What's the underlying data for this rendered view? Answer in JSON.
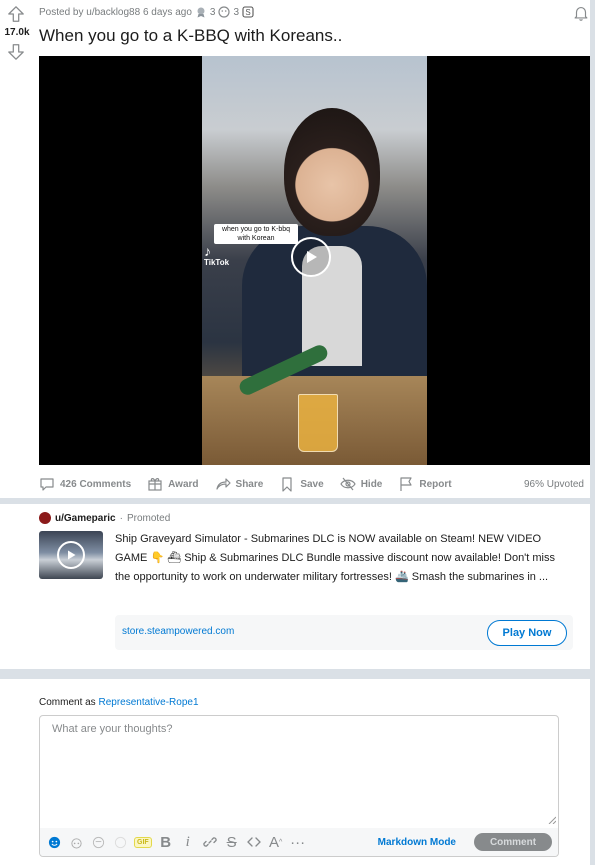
{
  "post": {
    "vote_count": "17.0k",
    "posted_by": "Posted by u/backlog88 6 days ago",
    "award_count_1": "3",
    "award_count_2": "3",
    "title": "When you go to a K-BBQ with Koreans..",
    "video": {
      "caption": "when you go to K-bbq with Korean",
      "watermark": "TikTok"
    },
    "actions": {
      "comments": "426 Comments",
      "award": "Award",
      "share": "Share",
      "save": "Save",
      "hide": "Hide",
      "report": "Report",
      "upvoted": "96% Upvoted"
    }
  },
  "ad": {
    "user": "u/Gameparic",
    "separator": "·",
    "promoted": "Promoted",
    "text": "Ship Graveyard Simulator - Submarines DLC is NOW available on Steam! NEW VIDEO GAME 👇 ⛴ Ship & Submarines DLC Bundle massive discount now available! Don't miss the opportunity to work on underwater military fortresses! 🚢 Smash the submarines in ...",
    "url": "store.steampowered.com",
    "cta": "Play Now"
  },
  "comment": {
    "comment_as_label": "Comment as",
    "username": "Representative-Rope1",
    "placeholder": "What are your thoughts?",
    "gif_label": "GIF",
    "markdown_mode": "Markdown Mode",
    "submit": "Comment"
  },
  "colors": {
    "accent": "#0079d3",
    "muted": "#878a8c",
    "page_bg": "#dae0e6"
  }
}
